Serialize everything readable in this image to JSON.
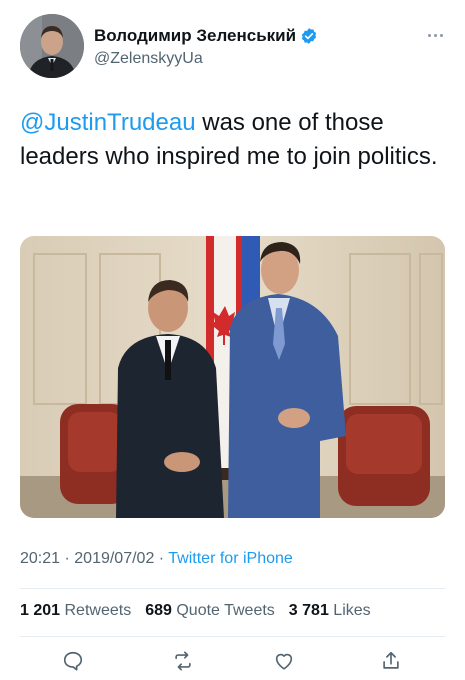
{
  "author": {
    "display_name": "Володимир Зеленський",
    "handle": "@ZelenskyyUa",
    "verified": true
  },
  "tweet": {
    "mention": "@JustinTrudeau",
    "text_rest": " was one of those leaders who inspired me to join politics."
  },
  "meta": {
    "time": "20:21",
    "separator": " · ",
    "date": "2019/07/02",
    "source": "Twitter for iPhone"
  },
  "stats": {
    "retweets_count": "1 201",
    "retweets_label": "Retweets",
    "quotes_count": "689",
    "quotes_label": "Quote Tweets",
    "likes_count": "3 781",
    "likes_label": "Likes"
  },
  "actions": [
    "reply-icon",
    "retweet-icon",
    "like-icon",
    "share-icon"
  ],
  "colors": {
    "link": "#1d9bf0",
    "secondary_text": "#536471",
    "primary_text": "#0f1419"
  }
}
